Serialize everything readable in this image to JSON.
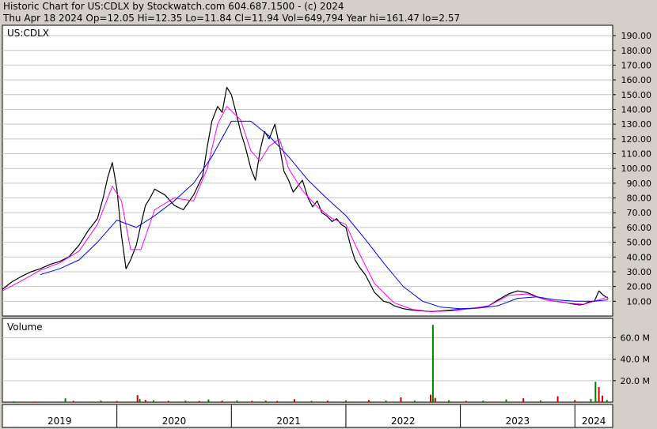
{
  "header": {
    "line1": "Historic Chart for US:CDLX by Stockwatch.com 604.687.1500 - (c) 2024",
    "line2": "Thu Apr 18 2024   Op=12.05   Hi=12.35   Lo=11.84   Cl=11.94   Vol=649,794   Year hi=161.47   lo=2.57"
  },
  "colors": {
    "background": "#d4d0c8",
    "plot_bg": "#ffffff",
    "price_line": "#000000",
    "ma_short": "#ff00ff",
    "ma_long": "#0000ff",
    "volume_up": "#008000",
    "volume_down": "#cc0000",
    "grid": "#c8c8c8"
  },
  "chart_data": [
    {
      "type": "line",
      "title": "US:CDLX",
      "ylabel": "",
      "ylim": [
        0,
        197
      ],
      "y_ticks": [
        "10.00",
        "20.00",
        "30.00",
        "40.00",
        "50.00",
        "60.00",
        "70.00",
        "80.00",
        "90.00",
        "100.00",
        "110.00",
        "120.00",
        "130.00",
        "140.00",
        "150.00",
        "160.00",
        "170.00",
        "180.00",
        "190.00"
      ],
      "x_range": [
        2019.0,
        2024.33
      ],
      "x_labels": [
        "2019",
        "2020",
        "2021",
        "2022",
        "2023",
        "2024"
      ],
      "grid": true,
      "series": [
        {
          "name": "",
          "role": "price",
          "x": [
            2019.0,
            2019.08,
            2019.17,
            2019.25,
            2019.33,
            2019.42,
            2019.5,
            2019.58,
            2019.67,
            2019.75,
            2019.83,
            2019.88,
            2019.92,
            2019.96,
            2020.0,
            2020.04,
            2020.08,
            2020.12,
            2020.17,
            2020.21,
            2020.25,
            2020.29,
            2020.33,
            2020.42,
            2020.5,
            2020.58,
            2020.67,
            2020.75,
            2020.79,
            2020.83,
            2020.88,
            2020.92,
            2020.96,
            2021.0,
            2021.04,
            2021.08,
            2021.12,
            2021.17,
            2021.21,
            2021.25,
            2021.29,
            2021.33,
            2021.38,
            2021.42,
            2021.46,
            2021.5,
            2021.54,
            2021.58,
            2021.62,
            2021.67,
            2021.71,
            2021.75,
            2021.79,
            2021.83,
            2021.88,
            2021.92,
            2021.96,
            2022.0,
            2022.04,
            2022.08,
            2022.12,
            2022.17,
            2022.21,
            2022.25,
            2022.29,
            2022.33,
            2022.38,
            2022.42,
            2022.5,
            2022.58,
            2022.67,
            2022.75,
            2022.83,
            2022.92,
            2023.0,
            2023.08,
            2023.17,
            2023.25,
            2023.33,
            2023.42,
            2023.5,
            2023.58,
            2023.67,
            2023.75,
            2023.83,
            2023.92,
            2024.0,
            2024.04,
            2024.08,
            2024.12,
            2024.17,
            2024.21,
            2024.25,
            2024.29
          ],
          "values": [
            18,
            23,
            27,
            30,
            32,
            35,
            37,
            40,
            48,
            58,
            66,
            80,
            94,
            104,
            86,
            55,
            32,
            38,
            48,
            62,
            75,
            80,
            86,
            82,
            75,
            72,
            82,
            95,
            115,
            132,
            142,
            138,
            155,
            150,
            138,
            125,
            115,
            100,
            92,
            112,
            125,
            120,
            130,
            115,
            98,
            92,
            84,
            88,
            92,
            80,
            74,
            78,
            70,
            68,
            64,
            66,
            62,
            60,
            48,
            38,
            33,
            28,
            22,
            16,
            13,
            10,
            9,
            7,
            5,
            4,
            3.5,
            3,
            3.5,
            4,
            4.5,
            5,
            5.5,
            7,
            11,
            15,
            17,
            16,
            13,
            11,
            10,
            9,
            8,
            7.5,
            8,
            9.5,
            10,
            17,
            14,
            12
          ]
        },
        {
          "name": "",
          "role": "short moving average",
          "x": [
            2019.0,
            2019.17,
            2019.33,
            2019.5,
            2019.67,
            2019.83,
            2019.96,
            2020.04,
            2020.12,
            2020.21,
            2020.33,
            2020.5,
            2020.67,
            2020.79,
            2020.88,
            2020.96,
            2021.08,
            2021.17,
            2021.25,
            2021.33,
            2021.42,
            2021.5,
            2021.62,
            2021.75,
            2021.88,
            2022.0,
            2022.12,
            2022.25,
            2022.42,
            2022.58,
            2022.75,
            2022.92,
            2023.08,
            2023.25,
            2023.42,
            2023.58,
            2023.75,
            2023.92,
            2024.08,
            2024.21,
            2024.29
          ],
          "values": [
            17,
            24,
            31,
            36,
            44,
            62,
            88,
            78,
            45,
            45,
            72,
            80,
            78,
            100,
            130,
            142,
            133,
            112,
            105,
            115,
            120,
            100,
            85,
            74,
            66,
            62,
            42,
            22,
            9,
            4.5,
            3,
            3.5,
            5,
            7,
            14,
            15,
            11,
            9,
            8,
            11,
            13
          ]
        },
        {
          "name": "",
          "role": "long moving average",
          "x": [
            2019.33,
            2019.5,
            2019.67,
            2019.83,
            2020.0,
            2020.17,
            2020.33,
            2020.5,
            2020.67,
            2020.83,
            2021.0,
            2021.17,
            2021.33,
            2021.5,
            2021.67,
            2021.83,
            2022.0,
            2022.17,
            2022.33,
            2022.5,
            2022.67,
            2022.83,
            2023.0,
            2023.17,
            2023.33,
            2023.5,
            2023.67,
            2023.83,
            2024.0,
            2024.17,
            2024.29
          ],
          "values": [
            28,
            32,
            38,
            50,
            65,
            60,
            68,
            78,
            90,
            108,
            132,
            132,
            122,
            108,
            92,
            80,
            68,
            52,
            36,
            20,
            10,
            6,
            5,
            5.5,
            7,
            12,
            13,
            11,
            10,
            10,
            11
          ]
        }
      ]
    },
    {
      "type": "bar",
      "title": "Volume",
      "ylim": [
        0,
        78
      ],
      "y_ticks": [
        "20.0 M",
        "40.0 M",
        "60.0 M"
      ],
      "x_range": [
        2019.0,
        2024.33
      ],
      "bars": [
        {
          "x": 2019.1,
          "value": 0.8,
          "up": true
        },
        {
          "x": 2019.28,
          "value": 0.6,
          "up": false
        },
        {
          "x": 2019.55,
          "value": 3.5,
          "up": true
        },
        {
          "x": 2019.62,
          "value": 1.2,
          "up": false
        },
        {
          "x": 2019.86,
          "value": 1.5,
          "up": true
        },
        {
          "x": 2020.0,
          "value": 1.0,
          "up": false
        },
        {
          "x": 2020.18,
          "value": 6.5,
          "up": false
        },
        {
          "x": 2020.2,
          "value": 3.0,
          "up": true
        },
        {
          "x": 2020.25,
          "value": 2.0,
          "up": false
        },
        {
          "x": 2020.32,
          "value": 1.8,
          "up": true
        },
        {
          "x": 2020.45,
          "value": 1.2,
          "up": false
        },
        {
          "x": 2020.6,
          "value": 1.5,
          "up": true
        },
        {
          "x": 2020.72,
          "value": 1.0,
          "up": false
        },
        {
          "x": 2020.8,
          "value": 2.5,
          "up": true
        },
        {
          "x": 2020.92,
          "value": 1.4,
          "up": false
        },
        {
          "x": 2021.05,
          "value": 1.6,
          "up": true
        },
        {
          "x": 2021.18,
          "value": 1.2,
          "up": false
        },
        {
          "x": 2021.3,
          "value": 1.5,
          "up": true
        },
        {
          "x": 2021.4,
          "value": 1.0,
          "up": false
        },
        {
          "x": 2021.55,
          "value": 2.8,
          "up": false
        },
        {
          "x": 2021.7,
          "value": 1.2,
          "up": true
        },
        {
          "x": 2021.84,
          "value": 1.4,
          "up": false
        },
        {
          "x": 2022.0,
          "value": 1.6,
          "up": true
        },
        {
          "x": 2022.2,
          "value": 2.0,
          "up": false
        },
        {
          "x": 2022.35,
          "value": 1.5,
          "up": true
        },
        {
          "x": 2022.48,
          "value": 4.5,
          "up": false
        },
        {
          "x": 2022.6,
          "value": 1.5,
          "up": true
        },
        {
          "x": 2022.74,
          "value": 7.0,
          "up": false
        },
        {
          "x": 2022.76,
          "value": 72.0,
          "up": true
        },
        {
          "x": 2022.78,
          "value": 4.0,
          "up": false
        },
        {
          "x": 2022.9,
          "value": 1.8,
          "up": true
        },
        {
          "x": 2023.05,
          "value": 1.2,
          "up": false
        },
        {
          "x": 2023.2,
          "value": 1.5,
          "up": true
        },
        {
          "x": 2023.4,
          "value": 2.5,
          "up": true
        },
        {
          "x": 2023.55,
          "value": 3.5,
          "up": false
        },
        {
          "x": 2023.7,
          "value": 1.6,
          "up": true
        },
        {
          "x": 2023.85,
          "value": 5.5,
          "up": false
        },
        {
          "x": 2024.0,
          "value": 2.0,
          "up": false
        },
        {
          "x": 2024.14,
          "value": 3.0,
          "up": true
        },
        {
          "x": 2024.18,
          "value": 19.0,
          "up": true
        },
        {
          "x": 2024.21,
          "value": 14.0,
          "up": false
        },
        {
          "x": 2024.24,
          "value": 6.0,
          "up": false
        },
        {
          "x": 2024.28,
          "value": 2.0,
          "up": true
        }
      ]
    }
  ]
}
